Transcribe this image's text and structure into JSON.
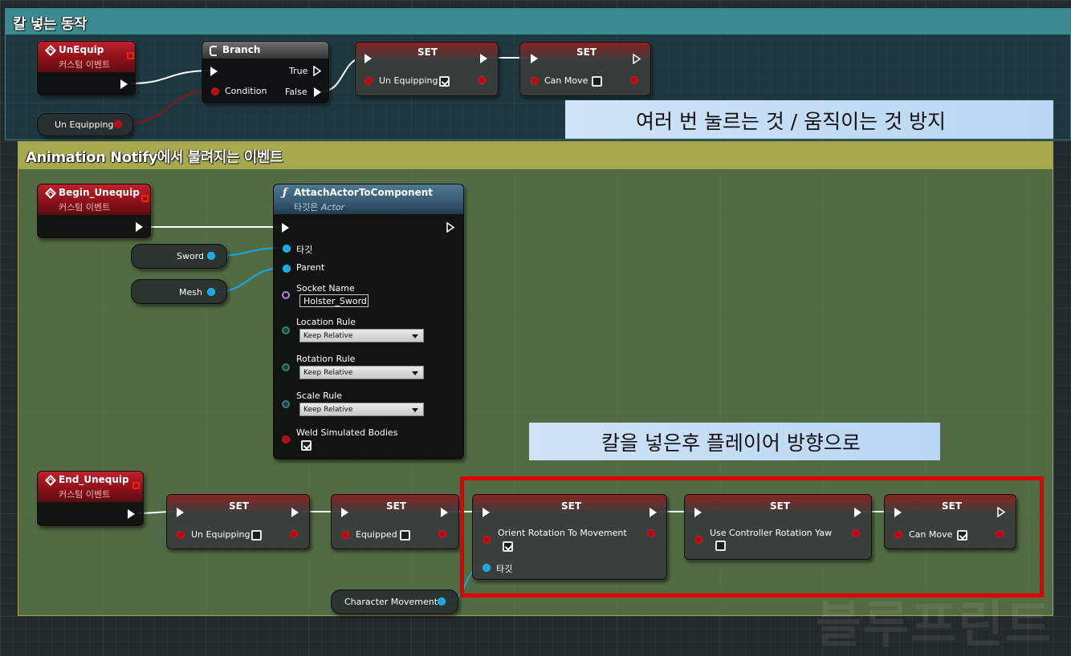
{
  "comments": {
    "top": {
      "title": "칼 넣는 동작"
    },
    "bottom": {
      "title": "Animation Notify에서 불려지는 이벤트"
    }
  },
  "notes": {
    "top": "여러 번 눌르는 것 / 움직이는 것 방지",
    "bottom": "칼을 넣은후  플레이어 방향으로"
  },
  "event_subtitle": "커스텀 이벤트",
  "set_title": "SET",
  "un_equip_event": {
    "title": "UnEquip"
  },
  "branch": {
    "title": "Branch",
    "true_label": "True",
    "false_label": "False",
    "condition_label": "Condition"
  },
  "top_sets": [
    {
      "var": "Un Equipping",
      "checked": true
    },
    {
      "var": "Can Move",
      "checked": false
    }
  ],
  "un_equipping_getter": "Un Equipping",
  "begin_unequip_event": {
    "title": "Begin_Unequip"
  },
  "attach": {
    "title": "AttachActorToComponent",
    "subtitle_prefix": "타깃은 ",
    "subtitle_target": "Actor",
    "target_label": "타깃",
    "parent_label": "Parent",
    "socket_label": "Socket Name",
    "socket_value": "Holster_Sword",
    "location_rule_label": "Location Rule",
    "location_rule_value": "Keep Relative",
    "rotation_rule_label": "Rotation Rule",
    "rotation_rule_value": "Keep Relative",
    "scale_rule_label": "Scale Rule",
    "scale_rule_value": "Keep Relative",
    "weld_label": "Weld Simulated Bodies",
    "weld_checked": true
  },
  "sword_getter": "Sword",
  "mesh_getter": "Mesh",
  "end_unequip_event": {
    "title": "End_Unequip"
  },
  "bottom_sets": [
    {
      "var": "Un Equipping",
      "checked": false
    },
    {
      "var": "Equipped",
      "checked": false
    },
    {
      "var": "Orient Rotation To Movement",
      "checked": true,
      "target_label": "타깃"
    },
    {
      "var": "Use Controller Rotation Yaw",
      "checked": false
    },
    {
      "var": "Can Move",
      "checked": true
    }
  ],
  "character_movement_getter": "Character Movement",
  "watermark": "블루프린트",
  "colors": {
    "exec": "#ffffff",
    "bool_pin": "#b30c12",
    "object_pin": "#18a6e8",
    "name_pin": "#b680e8",
    "enum_pin": "#3b7d72",
    "highlight": "#e00000"
  }
}
